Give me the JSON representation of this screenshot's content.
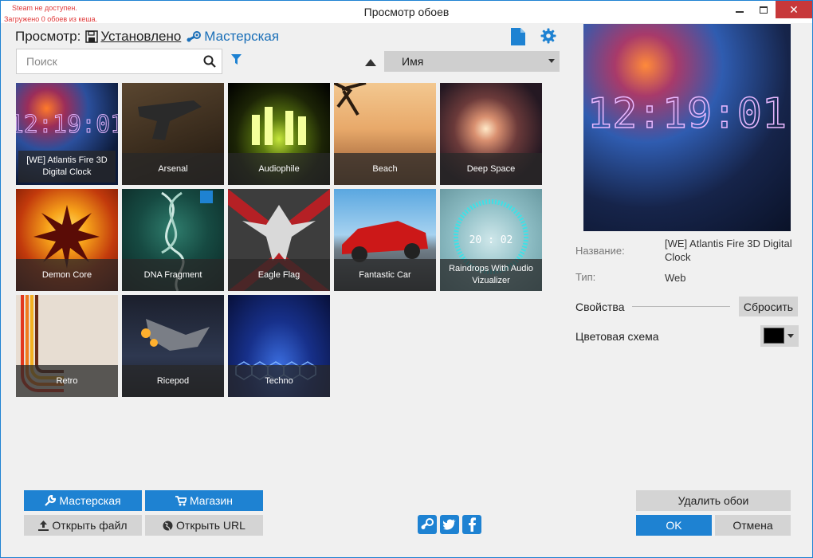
{
  "window": {
    "title": "Просмотр обоев",
    "status_line1": "Steam не доступен.",
    "status_line2": "Загружено 0 обоев из кеша."
  },
  "view": {
    "label": "Просмотр:",
    "installed": "Установлено",
    "workshop": "Мастерская"
  },
  "search": {
    "placeholder": "Поиск",
    "value": ""
  },
  "sort": {
    "selected": "Имя",
    "direction": "ascending"
  },
  "wallpapers": [
    {
      "name": "[WE] Atlantis Fire 3D Digital Clock",
      "selected": true
    },
    {
      "name": "Arsenal"
    },
    {
      "name": "Audiophile"
    },
    {
      "name": "Beach"
    },
    {
      "name": "Deep Space"
    },
    {
      "name": "Demon Core"
    },
    {
      "name": "DNA Fragment"
    },
    {
      "name": "Eagle Flag"
    },
    {
      "name": "Fantastic Car"
    },
    {
      "name": "Raindrops With Audio Vizualizer"
    },
    {
      "name": "Retro"
    },
    {
      "name": "Ricepod"
    },
    {
      "name": "Techno"
    }
  ],
  "preview": {
    "clock_text": "12:19:01"
  },
  "details": {
    "name_label": "Название:",
    "name_value": "[WE] Atlantis Fire 3D Digital Clock",
    "type_label": "Тип:",
    "type_value": "Web",
    "properties_label": "Свойства",
    "reset_label": "Сбросить",
    "color_scheme_label": "Цветовая схема",
    "color_scheme_value": "#000000"
  },
  "raindrops_time": "20 : 02",
  "buttons": {
    "workshop": "Мастерская",
    "shop": "Магазин",
    "open_file": "Открыть файл",
    "open_url": "Открыть URL",
    "delete": "Удалить обои",
    "ok": "OK",
    "cancel": "Отмена"
  },
  "colors": {
    "accent": "#1e82d2",
    "close": "#c7383a",
    "status_error": "#e03a3a"
  }
}
